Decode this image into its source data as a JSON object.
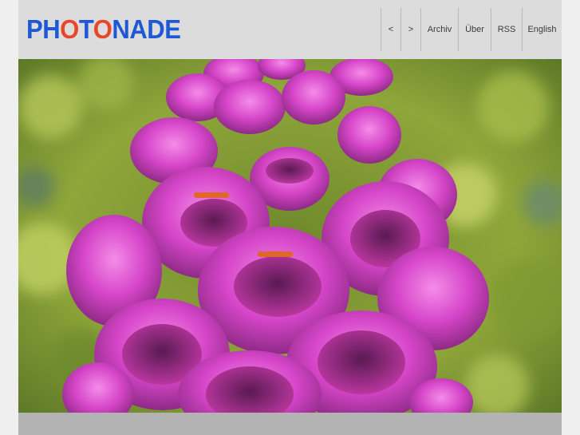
{
  "logo": {
    "segments": [
      {
        "text": "PH",
        "color": "#1f58d6"
      },
      {
        "text": "O",
        "color": "#e8452a"
      },
      {
        "text": "T",
        "color": "#1f58d6"
      },
      {
        "text": "O",
        "color": "#e8452a"
      },
      {
        "text": "NADE",
        "color": "#1f58d6"
      }
    ]
  },
  "nav": {
    "prev": "<",
    "next": ">",
    "archive": "Archiv",
    "about": "Über",
    "rss": "RSS",
    "language": "English"
  },
  "colors": {
    "brand_blue": "#1f58d6",
    "brand_orange": "#e8452a",
    "header_bg": "#dcdcdc",
    "footer_bar": "#b3b3b3"
  }
}
